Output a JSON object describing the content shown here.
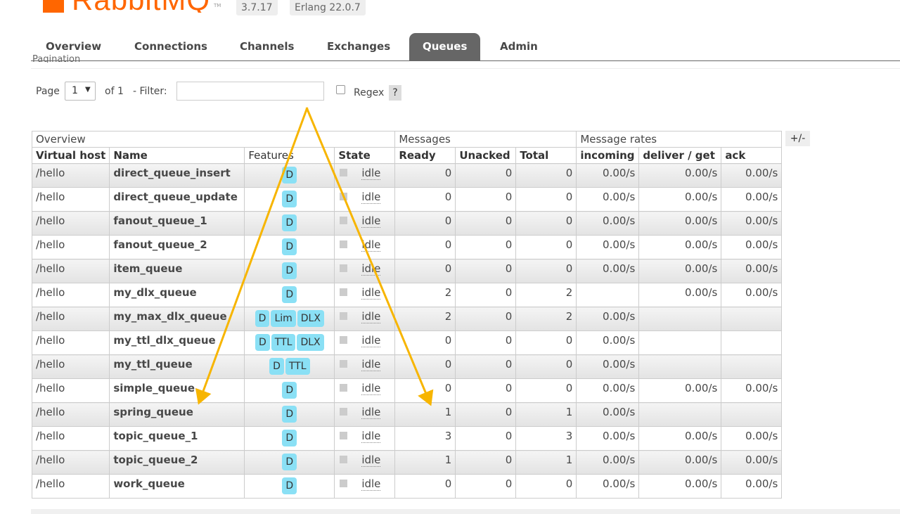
{
  "header": {
    "logo_text": "RabbitMQ",
    "logo_tm": "TM",
    "version": "3.7.17",
    "erlang": "Erlang 22.0.7"
  },
  "tabs": [
    {
      "label": "Overview",
      "active": false
    },
    {
      "label": "Connections",
      "active": false
    },
    {
      "label": "Channels",
      "active": false
    },
    {
      "label": "Exchanges",
      "active": false
    },
    {
      "label": "Queues",
      "active": true
    },
    {
      "label": "Admin",
      "active": false
    }
  ],
  "pagination": {
    "legend": "Pagination",
    "page_label": "Page",
    "page_value": "1",
    "of_label": "of 1",
    "filter_label": "- Filter:",
    "filter_value": "",
    "regex_label": "Regex",
    "help_label": "?"
  },
  "table": {
    "groups": [
      "Overview",
      "Messages",
      "Message rates"
    ],
    "columns": [
      "Virtual host",
      "Name",
      "Features",
      "State",
      "Ready",
      "Unacked",
      "Total",
      "incoming",
      "deliver / get",
      "ack"
    ],
    "toggle_label": "+/-",
    "rows": [
      {
        "vhost": "/hello",
        "name": "direct_queue_insert",
        "features": [
          "D"
        ],
        "state": "idle",
        "ready": "0",
        "unacked": "0",
        "total": "0",
        "incoming": "0.00/s",
        "deliver": "0.00/s",
        "ack": "0.00/s"
      },
      {
        "vhost": "/hello",
        "name": "direct_queue_update",
        "features": [
          "D"
        ],
        "state": "idle",
        "ready": "0",
        "unacked": "0",
        "total": "0",
        "incoming": "0.00/s",
        "deliver": "0.00/s",
        "ack": "0.00/s"
      },
      {
        "vhost": "/hello",
        "name": "fanout_queue_1",
        "features": [
          "D"
        ],
        "state": "idle",
        "ready": "0",
        "unacked": "0",
        "total": "0",
        "incoming": "0.00/s",
        "deliver": "0.00/s",
        "ack": "0.00/s"
      },
      {
        "vhost": "/hello",
        "name": "fanout_queue_2",
        "features": [
          "D"
        ],
        "state": "idle",
        "ready": "0",
        "unacked": "0",
        "total": "0",
        "incoming": "0.00/s",
        "deliver": "0.00/s",
        "ack": "0.00/s"
      },
      {
        "vhost": "/hello",
        "name": "item_queue",
        "features": [
          "D"
        ],
        "state": "idle",
        "ready": "0",
        "unacked": "0",
        "total": "0",
        "incoming": "0.00/s",
        "deliver": "0.00/s",
        "ack": "0.00/s"
      },
      {
        "vhost": "/hello",
        "name": "my_dlx_queue",
        "features": [
          "D"
        ],
        "state": "idle",
        "ready": "2",
        "unacked": "0",
        "total": "2",
        "incoming": "",
        "deliver": "0.00/s",
        "ack": "0.00/s"
      },
      {
        "vhost": "/hello",
        "name": "my_max_dlx_queue",
        "features": [
          "D",
          "Lim",
          "DLX"
        ],
        "state": "idle",
        "ready": "2",
        "unacked": "0",
        "total": "2",
        "incoming": "0.00/s",
        "deliver": "",
        "ack": ""
      },
      {
        "vhost": "/hello",
        "name": "my_ttl_dlx_queue",
        "features": [
          "D",
          "TTL",
          "DLX"
        ],
        "state": "idle",
        "ready": "0",
        "unacked": "0",
        "total": "0",
        "incoming": "0.00/s",
        "deliver": "",
        "ack": ""
      },
      {
        "vhost": "/hello",
        "name": "my_ttl_queue",
        "features": [
          "D",
          "TTL"
        ],
        "state": "idle",
        "ready": "0",
        "unacked": "0",
        "total": "0",
        "incoming": "0.00/s",
        "deliver": "",
        "ack": ""
      },
      {
        "vhost": "/hello",
        "name": "simple_queue",
        "features": [
          "D"
        ],
        "state": "idle",
        "ready": "0",
        "unacked": "0",
        "total": "0",
        "incoming": "0.00/s",
        "deliver": "0.00/s",
        "ack": "0.00/s"
      },
      {
        "vhost": "/hello",
        "name": "spring_queue",
        "features": [
          "D"
        ],
        "state": "idle",
        "ready": "1",
        "unacked": "0",
        "total": "1",
        "incoming": "0.00/s",
        "deliver": "",
        "ack": ""
      },
      {
        "vhost": "/hello",
        "name": "topic_queue_1",
        "features": [
          "D"
        ],
        "state": "idle",
        "ready": "3",
        "unacked": "0",
        "total": "3",
        "incoming": "0.00/s",
        "deliver": "0.00/s",
        "ack": "0.00/s"
      },
      {
        "vhost": "/hello",
        "name": "topic_queue_2",
        "features": [
          "D"
        ],
        "state": "idle",
        "ready": "1",
        "unacked": "0",
        "total": "1",
        "incoming": "0.00/s",
        "deliver": "0.00/s",
        "ack": "0.00/s"
      },
      {
        "vhost": "/hello",
        "name": "work_queue",
        "features": [
          "D"
        ],
        "state": "idle",
        "ready": "0",
        "unacked": "0",
        "total": "0",
        "incoming": "0.00/s",
        "deliver": "0.00/s",
        "ack": "0.00/s"
      }
    ]
  },
  "annotation": {
    "arrow_color": "#f7b500"
  },
  "colors": {
    "accent": "#ff6600",
    "badge": "#8ae0f5",
    "active_tab": "#666666"
  }
}
